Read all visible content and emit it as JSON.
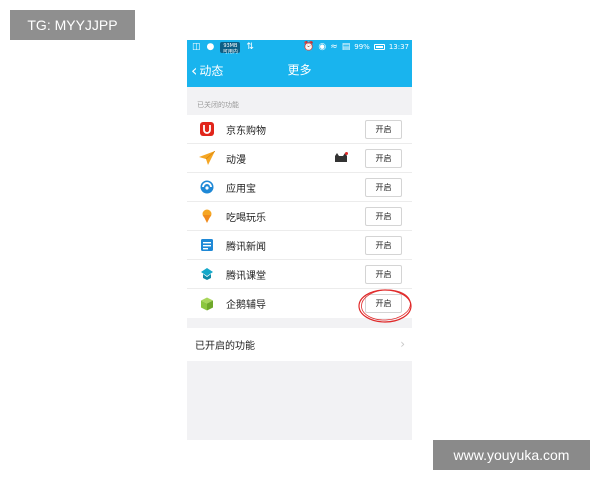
{
  "watermarks": {
    "top_left": "TG: MYYJJPP",
    "bottom_right": "www.youyuka.com"
  },
  "status_bar": {
    "badge_line1": "93MB",
    "badge_line2": "可用内存",
    "battery_percent": "99%",
    "time": "13:37"
  },
  "title_bar": {
    "back_label": "动态",
    "title": "更多"
  },
  "disabled_section": {
    "heading": "已关闭的功能",
    "items": [
      {
        "label": "京东购物",
        "button": "开启",
        "icon": "jd-shopping-icon",
        "color": "#e1251b"
      },
      {
        "label": "动漫",
        "button": "开启",
        "icon": "paper-plane-icon",
        "color": "#f5a623"
      },
      {
        "label": "应用宝",
        "button": "开启",
        "icon": "app-store-icon",
        "color": "#1e88d6"
      },
      {
        "label": "吃喝玩乐",
        "button": "开启",
        "icon": "ice-cream-icon",
        "color": "#f5a623"
      },
      {
        "label": "腾讯新闻",
        "button": "开启",
        "icon": "news-icon",
        "color": "#1e88d6"
      },
      {
        "label": "腾讯课堂",
        "button": "开启",
        "icon": "classroom-icon",
        "color": "#14a8c9"
      },
      {
        "label": "企鹅辅导",
        "button": "开启",
        "icon": "tutoring-cube-icon",
        "color": "#8cc63f"
      }
    ]
  },
  "enabled_section": {
    "label": "已开启的功能"
  },
  "colors": {
    "accent": "#19b4ee",
    "annotation": "#e02a2a"
  }
}
